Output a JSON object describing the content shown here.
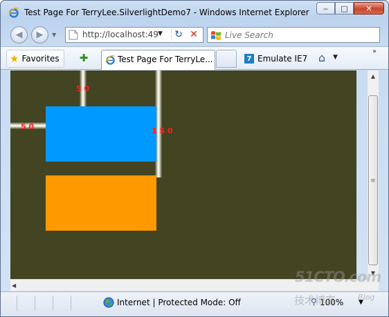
{
  "window": {
    "title": "Test Page For TerryLee.SilverlightDemo7 - Windows Internet Explorer",
    "minimize_glyph": "‒",
    "maximize_glyph": "□",
    "close_glyph": "✕"
  },
  "navigation": {
    "back_icon": "back-arrow-icon",
    "forward_icon": "forward-arrow-icon",
    "address_url": "http://localhost:49",
    "refresh_glyph": "↻",
    "stop_glyph": "✕",
    "search_placeholder": "Live Search"
  },
  "toolbar": {
    "favorites_label": "Favorites",
    "active_tab_label": "Test Page For TerryLe...",
    "emulate_badge": "7",
    "emulate_label": "Emulate IE7",
    "home_glyph": "⌂",
    "more_glyph": "»"
  },
  "content": {
    "background_color": "#434422",
    "blue_rect_color": "#0099ff",
    "orange_rect_color": "#ff9900",
    "label_top": "5 0",
    "label_left": "5 0",
    "label_right": "1 5 0"
  },
  "status_bar": {
    "zone_text": "Internet | Protected Mode: Off",
    "zoom_text": "100%"
  },
  "watermark": {
    "site": "51CTO.com",
    "chinese": "技术博客",
    "blog": "Blog"
  }
}
